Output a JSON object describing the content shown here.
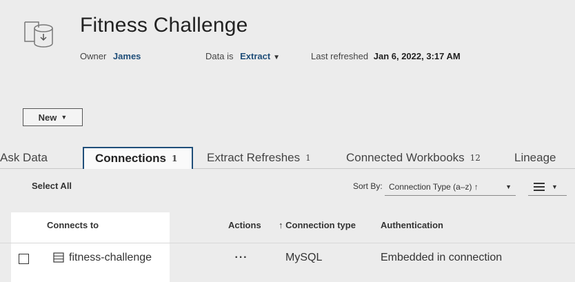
{
  "header": {
    "title": "Fitness Challenge",
    "owner_label": "Owner",
    "owner_value": "James",
    "data_label": "Data is",
    "data_value": "Extract",
    "refresh_label": "Last refreshed",
    "refresh_value": "Jan 6, 2022, 3:17 AM",
    "icon": "data-source-icon"
  },
  "new_button": {
    "label": "New"
  },
  "tabs": [
    {
      "label": "Ask Data",
      "count": ""
    },
    {
      "label": "Connections",
      "count": "1"
    },
    {
      "label": "Extract Refreshes",
      "count": "1"
    },
    {
      "label": "Connected Workbooks",
      "count": "12"
    },
    {
      "label": "Lineage",
      "count": ""
    }
  ],
  "active_tab": "Connections",
  "toolbar": {
    "select_all": "Select All",
    "sort_label": "Sort By:",
    "sort_value": "Connection Type (a–z) ↑",
    "view_icon": "list-view-icon"
  },
  "table": {
    "columns": [
      "Connects to",
      "Actions",
      "↑ Connection type",
      "Authentication"
    ],
    "rows": [
      {
        "connects_to": "fitness-challenge",
        "actions": "···",
        "connection_type": "MySQL",
        "authentication": "Embedded in connection"
      }
    ]
  },
  "colors": {
    "accent": "#1f4e79",
    "background": "#ececec",
    "panel": "#ffffff"
  }
}
